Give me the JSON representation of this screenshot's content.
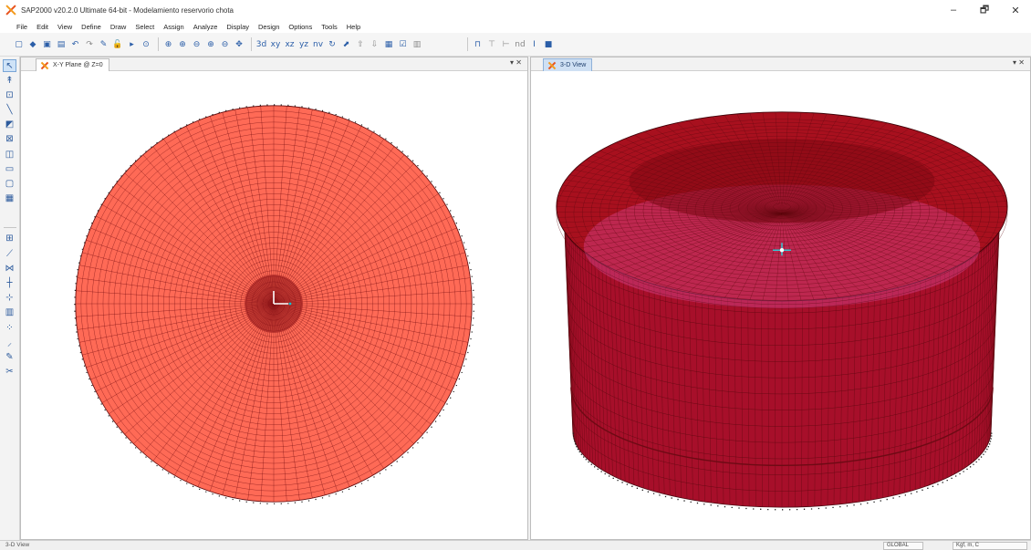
{
  "window": {
    "title": "SAP2000 v20.2.0 Ultimate 64-bit - Modelamiento reservorio chota",
    "controls": {
      "minimize": "–",
      "restore": "🗗",
      "close": "✕"
    }
  },
  "menu": [
    "File",
    "Edit",
    "View",
    "Define",
    "Draw",
    "Select",
    "Assign",
    "Analyze",
    "Display",
    "Design",
    "Options",
    "Tools",
    "Help"
  ],
  "toolbar": {
    "left_icons": [
      {
        "glyph": "▢",
        "name": "new-model-icon",
        "tone": ""
      },
      {
        "glyph": "◆",
        "name": "open-icon",
        "tone": ""
      },
      {
        "glyph": "▣",
        "name": "save-icon",
        "tone": ""
      },
      {
        "glyph": "▤",
        "name": "print-icon",
        "tone": ""
      },
      {
        "glyph": "↶",
        "name": "undo-icon",
        "tone": ""
      },
      {
        "glyph": "↷",
        "name": "redo-icon",
        "tone": "gray"
      },
      {
        "glyph": "✎",
        "name": "pencil-icon",
        "tone": ""
      },
      {
        "glyph": "🔓",
        "name": "lock-icon",
        "tone": ""
      },
      {
        "glyph": "▸",
        "name": "run-analysis-icon",
        "tone": ""
      },
      {
        "glyph": "⊙",
        "name": "run-now-icon",
        "tone": ""
      },
      {
        "glyph": "⊕",
        "name": "zoom-window-icon",
        "tone": ""
      },
      {
        "glyph": "⊕",
        "name": "zoom-in-icon",
        "tone": ""
      },
      {
        "glyph": "⊖",
        "name": "zoom-out-icon",
        "tone": ""
      },
      {
        "glyph": "⊕",
        "name": "zoom-fit-icon",
        "tone": ""
      },
      {
        "glyph": "⊖",
        "name": "zoom-previous-icon",
        "tone": ""
      },
      {
        "glyph": "✥",
        "name": "pan-icon",
        "tone": ""
      },
      {
        "glyph": "3d",
        "name": "view-3d-icon",
        "tone": ""
      },
      {
        "glyph": "xy",
        "name": "view-xy-icon",
        "tone": ""
      },
      {
        "glyph": "xz",
        "name": "view-xz-icon",
        "tone": ""
      },
      {
        "glyph": "yz",
        "name": "view-yz-icon",
        "tone": ""
      },
      {
        "glyph": "nv",
        "name": "view-nv-icon",
        "tone": ""
      },
      {
        "glyph": "↻",
        "name": "rotate-icon",
        "tone": ""
      },
      {
        "glyph": "⬈",
        "name": "perspective-icon",
        "tone": ""
      },
      {
        "glyph": "⇧",
        "name": "move-up-icon",
        "tone": "gray"
      },
      {
        "glyph": "⇩",
        "name": "move-down-icon",
        "tone": "gray"
      },
      {
        "glyph": "▦",
        "name": "display-options-icon",
        "tone": ""
      },
      {
        "glyph": "☑",
        "name": "object-shrink-icon",
        "tone": ""
      },
      {
        "glyph": "▥",
        "name": "refresh-icon",
        "tone": "gray"
      }
    ],
    "right_icons": [
      {
        "glyph": "⊓",
        "name": "frame-section-icon",
        "tone": ""
      },
      {
        "glyph": "⊤",
        "name": "draw-frame-icon",
        "tone": "gray"
      },
      {
        "glyph": "⊢",
        "name": "draw-link-icon",
        "tone": "gray"
      },
      {
        "glyph": "nd",
        "name": "node-icon",
        "tone": "gray"
      },
      {
        "glyph": "I",
        "name": "section-i-icon",
        "tone": ""
      },
      {
        "glyph": "■",
        "name": "area-section-icon",
        "tone": ""
      }
    ]
  },
  "vtoolbar_top": [
    {
      "glyph": "↖",
      "name": "pointer-icon",
      "selected": true
    },
    {
      "glyph": "↟",
      "name": "reshaper-icon",
      "selected": false
    },
    {
      "glyph": "⊡",
      "name": "draw-joint-icon",
      "selected": false
    },
    {
      "glyph": "╲",
      "name": "draw-frame-cable-icon",
      "selected": false
    },
    {
      "glyph": "◩",
      "name": "quick-draw-frame-icon",
      "selected": false
    },
    {
      "glyph": "⊠",
      "name": "quick-draw-braces-icon",
      "selected": false
    },
    {
      "glyph": "◫",
      "name": "draw-secondary-beams-icon",
      "selected": false
    },
    {
      "glyph": "▭",
      "name": "draw-poly-area-icon",
      "selected": false
    },
    {
      "glyph": "▢",
      "name": "draw-rect-area-icon",
      "selected": false
    },
    {
      "glyph": "▦",
      "name": "quick-draw-area-icon",
      "selected": false
    }
  ],
  "vtoolbar_bottom": [
    {
      "glyph": "⊞",
      "name": "select-all-icon",
      "selected": false
    },
    {
      "glyph": "⟋",
      "name": "intersecting-line-icon",
      "selected": false
    },
    {
      "glyph": "⋈",
      "name": "select-polygon-icon",
      "selected": false
    },
    {
      "glyph": "┼",
      "name": "snap-points-icon",
      "selected": false
    },
    {
      "glyph": "⊹",
      "name": "snap-intersections-icon",
      "selected": false
    },
    {
      "glyph": "▥",
      "name": "snap-grid-icon",
      "selected": false
    },
    {
      "glyph": "⁘",
      "name": "snap-midpoints-icon",
      "selected": false
    },
    {
      "glyph": "⸝",
      "name": "snap-lines-icon",
      "selected": false
    },
    {
      "glyph": "✎",
      "name": "snap-perpendicular-icon",
      "selected": false
    },
    {
      "glyph": "✂",
      "name": "snap-fine-grid-icon",
      "selected": false
    }
  ],
  "panes": {
    "left": {
      "tab": "X-Y Plane @ Z=0",
      "controls": "▾ ✕"
    },
    "right": {
      "tab": "3-D View",
      "controls": "▾ ✕"
    }
  },
  "model_colors": {
    "plan_fill": "#ff6a56",
    "plan_grid": "#7a0f12",
    "dome_fill": "#a8101e",
    "dome_grid": "#610810",
    "wall_fill": "#a70f2a",
    "highlight": "#e04fa0"
  },
  "status": {
    "left": "3-D View",
    "coord_system": "GLOBAL",
    "units": "Kgf, m, C"
  }
}
